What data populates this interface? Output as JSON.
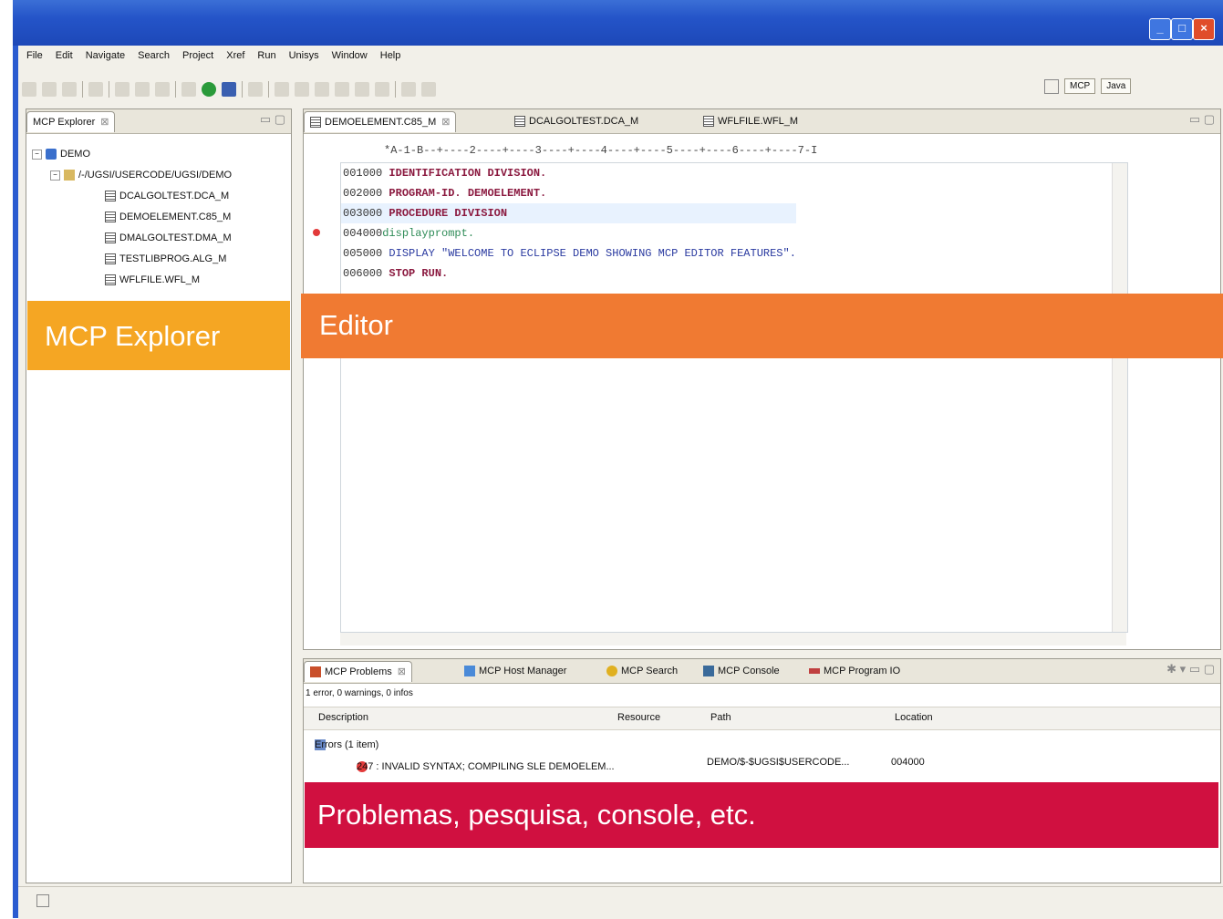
{
  "window": {
    "minimize": "_",
    "maximize": "□",
    "close": "×"
  },
  "menu": [
    "File",
    "Edit",
    "Navigate",
    "Search",
    "Project",
    "Xref",
    "Run",
    "Unisys",
    "Window",
    "Help"
  ],
  "perspectives": {
    "mcp": "MCP",
    "java": "Java"
  },
  "explorer": {
    "tab_label": "MCP Explorer",
    "root": "DEMO",
    "folder": "/-/UGSI/USERCODE/UGSI/DEMO",
    "files": [
      "DCALGOLTEST.DCA_M",
      "DEMOELEMENT.C85_M",
      "DMALGOLTEST.DMA_M",
      "TESTLIBPROG.ALG_M",
      "WFLFILE.WFL_M"
    ]
  },
  "editor": {
    "tabs": [
      "DEMOELEMENT.C85_M",
      "DCALGOLTEST.DCA_M",
      "WFLFILE.WFL_M"
    ],
    "ruler": "*A-1-B--+----2----+----3----+----4----+----5----+----6----+----7-I",
    "lines": [
      {
        "seq": "001000",
        "text": "IDENTIFICATION DIVISION."
      },
      {
        "seq": "002000",
        "text": "PROGRAM-ID. DEMOELEMENT."
      },
      {
        "seq": "003000",
        "text": "PROCEDURE DIVISION"
      },
      {
        "seq": "004000",
        "text": "displayprompt."
      },
      {
        "seq": "005000",
        "text": "DISPLAY \"WELCOME TO ECLIPSE DEMO SHOWING MCP EDITOR FEATURES\"."
      },
      {
        "seq": "006000",
        "text": "STOP RUN."
      }
    ]
  },
  "problems": {
    "tabs": [
      "MCP Problems",
      "MCP Host Manager",
      "MCP Search",
      "MCP Console",
      "MCP Program IO"
    ],
    "summary": "1 error, 0 warnings, 0 infos",
    "columns": [
      "Description",
      "Resource",
      "Path",
      "Location"
    ],
    "group": "Errors (1 item)",
    "row": {
      "description": "247 : INVALID SYNTAX; COMPILING SLE DEMOELEM...",
      "path": "DEMO/$-$UGSI$USERCODE...",
      "location": "004000"
    }
  },
  "overlays": {
    "explorer": "MCP Explorer",
    "editor": "Editor",
    "problems": "Problemas, pesquisa, console, etc."
  },
  "colors": {
    "explorer_label": "#f5a623",
    "editor_label": "#f07a32",
    "problems_label": "#d01040",
    "title_bar": "#2454c8"
  }
}
